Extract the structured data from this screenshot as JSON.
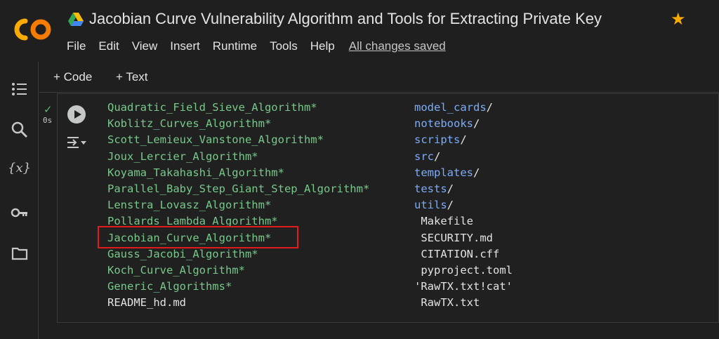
{
  "header": {
    "title": "Jacobian Curve Vulnerability Algorithm and Tools for Extracting Private Key",
    "logo_text": "CO",
    "menu": [
      "File",
      "Edit",
      "View",
      "Insert",
      "Runtime",
      "Tools",
      "Help"
    ],
    "save_status": "All changes saved"
  },
  "toolbar": {
    "add_code": "+ Code",
    "add_text": "+ Text"
  },
  "cell": {
    "exec_time": "0s",
    "left_column": [
      {
        "text": "Quadratic_Field_Sieve_Algorithm*",
        "color": "green"
      },
      {
        "text": "Koblitz_Curves_Algorithm*",
        "color": "green"
      },
      {
        "text": "Scott_Lemieux_Vanstone_Algorithm*",
        "color": "green"
      },
      {
        "text": "Joux_Lercier_Algorithm*",
        "color": "green"
      },
      {
        "text": "Koyama_Takahashi_Algorithm*",
        "color": "green"
      },
      {
        "text": "Parallel_Baby_Step_Giant_Step_Algorithm*",
        "color": "green"
      },
      {
        "text": "Lenstra_Lovasz_Algorithm*",
        "color": "green"
      },
      {
        "text": "Pollards_Lambda_Algorithm*",
        "color": "green"
      },
      {
        "text": "Jacobian_Curve_Algorithm*",
        "color": "green"
      },
      {
        "text": "Gauss_Jacobi_Algorithm*",
        "color": "green"
      },
      {
        "text": "Koch_Curve_Algorithm*",
        "color": "green"
      },
      {
        "text": "Generic_Algorithms*",
        "color": "green"
      },
      {
        "text": "README_hd.md",
        "color": "white"
      }
    ],
    "right_column": [
      {
        "name": "model_cards",
        "suffix": "/",
        "color": "blue"
      },
      {
        "name": "notebooks",
        "suffix": "/",
        "color": "blue"
      },
      {
        "name": "scripts",
        "suffix": "/",
        "color": "blue"
      },
      {
        "name": "src",
        "suffix": "/",
        "color": "blue"
      },
      {
        "name": "templates",
        "suffix": "/",
        "color": "blue"
      },
      {
        "name": "tests",
        "suffix": "/",
        "color": "blue"
      },
      {
        "name": "utils",
        "suffix": "/",
        "color": "blue"
      },
      {
        "name": " Makefile",
        "suffix": "",
        "color": "white"
      },
      {
        "name": " SECURITY.md",
        "suffix": "",
        "color": "white"
      },
      {
        "name": " CITATION.cff",
        "suffix": "",
        "color": "white"
      },
      {
        "name": " pyproject.toml",
        "suffix": "",
        "color": "white"
      },
      {
        "name": "'RawTX.txt!cat'",
        "suffix": "",
        "color": "white"
      },
      {
        "name": " RawTX.txt",
        "suffix": "",
        "color": "white"
      }
    ],
    "highlighted_item": "Jacobian_Curve_Algorithm*"
  },
  "colors": {
    "accent_star": "#f9ab00",
    "highlight_border": "#e01b1b",
    "executable": "#77c98a",
    "directory": "#7cacf8"
  }
}
